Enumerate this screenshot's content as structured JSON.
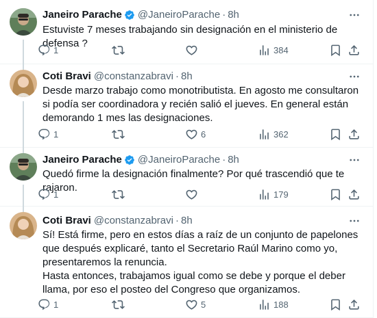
{
  "tweets": [
    {
      "author_name": "Janeiro Parache",
      "author_handle": "@JaneiroParache",
      "separator": "·",
      "time": "8h",
      "text": "Estuviste 7 meses trabajando sin designación en el ministerio de defensa ?",
      "replies": "1",
      "retweets": "",
      "likes": "",
      "views": "384",
      "verified": true
    },
    {
      "author_name": "Coti Bravi",
      "author_handle": "@constanzabravi",
      "separator": "·",
      "time": "8h",
      "text": "Desde marzo trabajo como monotributista. En agosto me consultaron si podía ser coordinadora y recién salió el jueves. En general están demorando 1 mes las designaciones.",
      "replies": "1",
      "retweets": "",
      "likes": "6",
      "views": "362",
      "verified": false
    },
    {
      "author_name": "Janeiro Parache",
      "author_handle": "@JaneiroParache",
      "separator": "·",
      "time": "8h",
      "text": "Quedó firme la designación finalmente? Por qué trascendió que te rajaron.",
      "replies": "1",
      "retweets": "",
      "likes": "",
      "views": "179",
      "verified": true
    },
    {
      "author_name": "Coti Bravi",
      "author_handle": "@constanzabravi",
      "separator": "·",
      "time": "8h",
      "text": "Sí! Está firme, pero en estos días a raíz de un conjunto de papelones que después explicaré, tanto el Secretario Raúl Marino como yo, presentaremos la renuncia.\nHasta entonces, trabajamos igual como se debe y porque el deber llama, por eso el posteo del Congreso que organizamos.",
      "replies": "1",
      "retweets": "",
      "likes": "5",
      "views": "188",
      "verified": false
    }
  ],
  "colors": {
    "text": "#0f1419",
    "secondary": "#536471",
    "verified": "#1d9bf0",
    "thread_line": "#cfd9de",
    "divider": "#eff3f4"
  },
  "icons": {
    "reply": "reply-icon",
    "retweet": "retweet-icon",
    "like": "like-icon",
    "views": "views-icon",
    "bookmark": "bookmark-icon",
    "share": "share-icon",
    "more": "more-icon",
    "verified": "verified-badge-icon"
  }
}
